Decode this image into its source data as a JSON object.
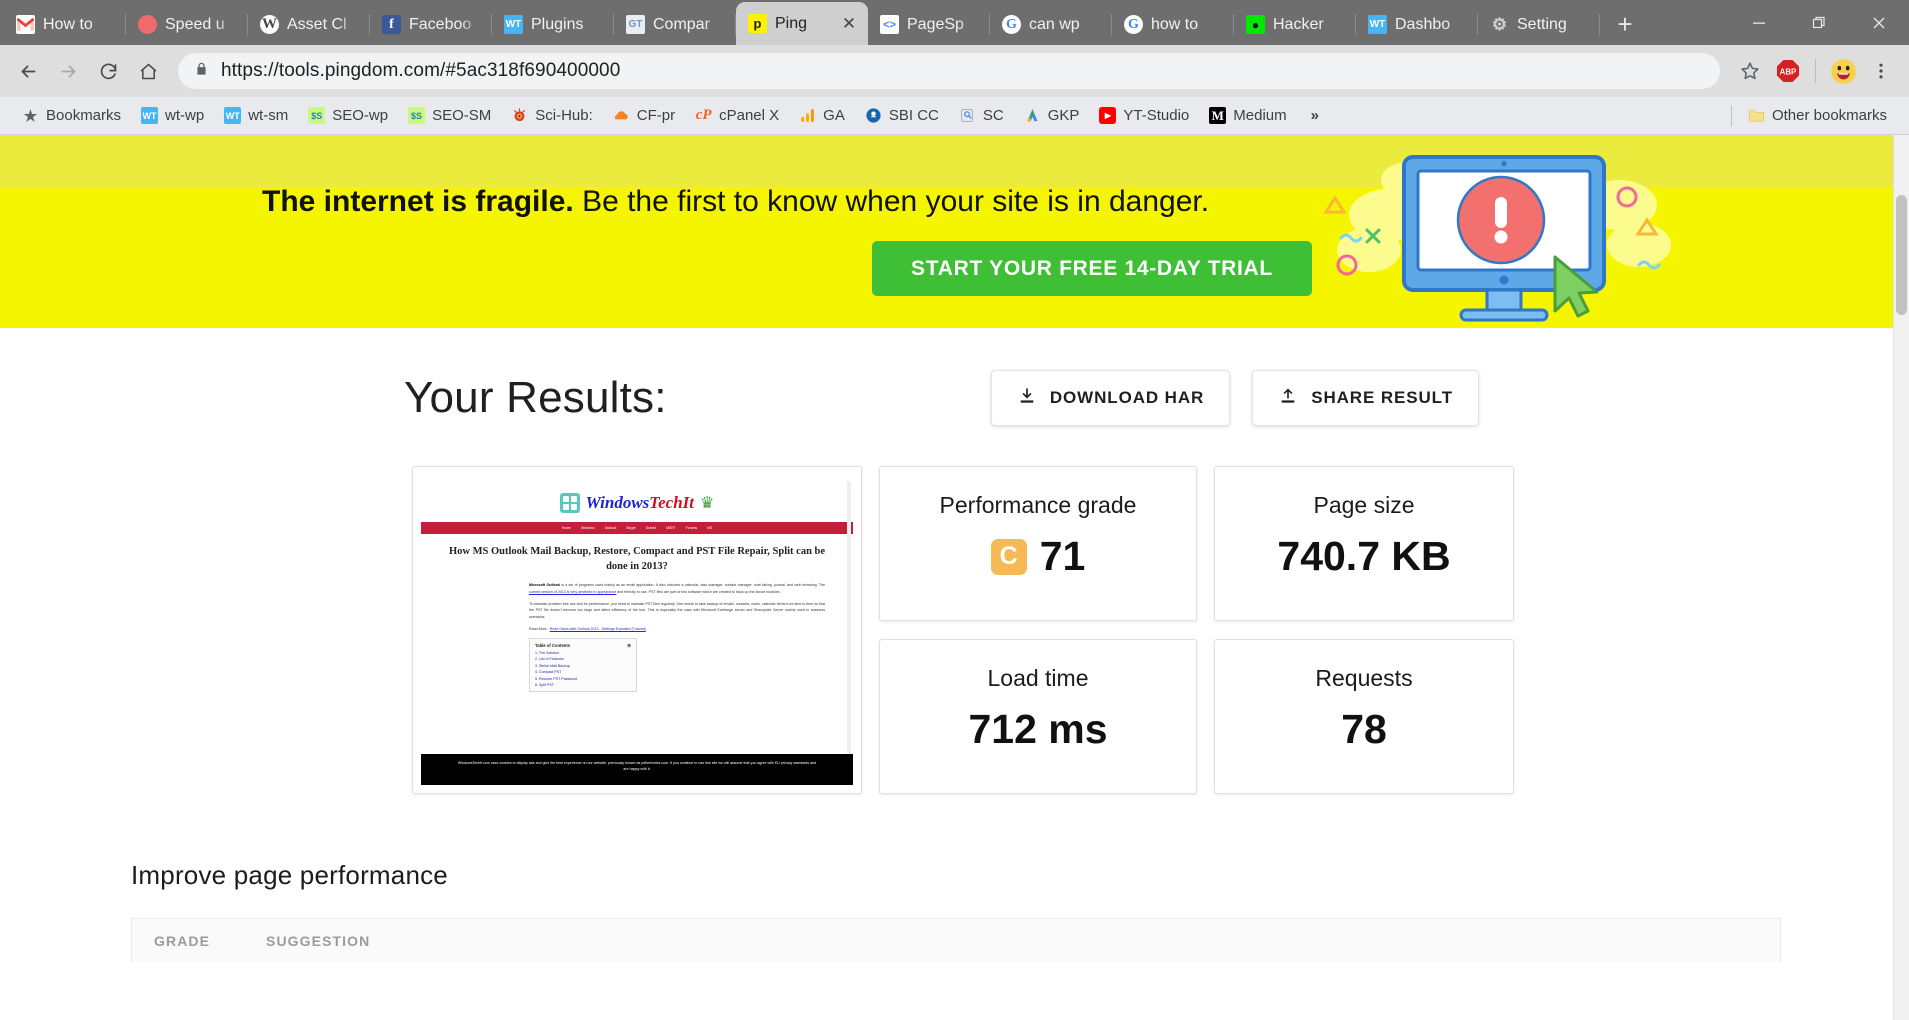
{
  "browser": {
    "tabs": [
      {
        "title": "How to",
        "favicon": "gmail-icon"
      },
      {
        "title": "Speed u",
        "favicon": "speed-icon"
      },
      {
        "title": "Asset Cl",
        "favicon": "wordpress-icon"
      },
      {
        "title": "Faceboo",
        "favicon": "facebook-icon"
      },
      {
        "title": "Plugins",
        "favicon": "wt-icon"
      },
      {
        "title": "Compar",
        "favicon": "gt-icon"
      },
      {
        "title": "Ping",
        "favicon": "pingdom-icon",
        "active": true
      },
      {
        "title": "PageSp",
        "favicon": "pagespeed-icon"
      },
      {
        "title": "can wp",
        "favicon": "google-icon"
      },
      {
        "title": "how to",
        "favicon": "google-icon"
      },
      {
        "title": "Hacker",
        "favicon": "hacker-icon"
      },
      {
        "title": "Dashbo",
        "favicon": "wt-icon"
      },
      {
        "title": "Setting",
        "favicon": "gear-icon"
      }
    ],
    "new_tab_label": "+",
    "window_controls": {
      "minimize": "—",
      "restore": "❐",
      "close": "✕"
    },
    "url": "https://tools.pingdom.com/#5ac318f690400000",
    "secure_icon": "lock-icon",
    "nav": {
      "back": "←",
      "forward": "→",
      "reload": "↻",
      "home": "⌂"
    },
    "toolbar_right": [
      {
        "name": "bookmark-star-icon",
        "label": "☆"
      },
      {
        "name": "adblock-plus-icon",
        "label": "ABP"
      },
      {
        "name": "profile-avatar",
        "label": "😃"
      },
      {
        "name": "chrome-menu-icon",
        "label": "⋮"
      }
    ],
    "bookmarks": [
      {
        "label": "Bookmarks",
        "icon": "star-icon"
      },
      {
        "label": "wt-wp",
        "icon": "wt-icon"
      },
      {
        "label": "wt-sm",
        "icon": "wt-icon"
      },
      {
        "label": "SEO-wp",
        "icon": "ss-icon"
      },
      {
        "label": "SEO-SM",
        "icon": "ss-icon"
      },
      {
        "label": "Sci-Hub:",
        "icon": "scihub-icon"
      },
      {
        "label": "CF-pr",
        "icon": "cloudflare-icon"
      },
      {
        "label": "cPanel X",
        "icon": "cpanel-icon"
      },
      {
        "label": "GA",
        "icon": "google-analytics-icon"
      },
      {
        "label": "SBI CC",
        "icon": "sbi-icon"
      },
      {
        "label": "SC",
        "icon": "search-console-icon"
      },
      {
        "label": "GKP",
        "icon": "google-keyword-planner-icon"
      },
      {
        "label": "YT-Studio",
        "icon": "youtube-icon"
      },
      {
        "label": "Medium",
        "icon": "medium-icon"
      }
    ],
    "bookmarks_overflow": "»",
    "other_bookmarks": {
      "label": "Other bookmarks",
      "icon": "folder-icon"
    }
  },
  "promo": {
    "headline_bold": "The internet is fragile.",
    "headline_rest": " Be the first to know when your site is in danger.",
    "cta_label": "START YOUR FREE 14-DAY TRIAL",
    "background_color": "#f5f500",
    "cta_color": "#3fbf36",
    "illustration": "monitor-alert-illustration"
  },
  "results": {
    "title": "Your Results:",
    "download_har_label": "DOWNLOAD HAR",
    "download_har_icon": "download-icon",
    "share_result_label": "SHARE RESULT",
    "share_result_icon": "share-upload-icon",
    "cards": [
      {
        "label": "Performance grade",
        "value": "71",
        "grade": "C",
        "grade_color": "#f5b955"
      },
      {
        "label": "Page size",
        "value": "740.7 KB"
      },
      {
        "label": "Load time",
        "value": "712 ms"
      },
      {
        "label": "Requests",
        "value": "78"
      }
    ]
  },
  "thumbnail": {
    "site_name_part1": "Windows",
    "site_name_part2": "TechIt",
    "nav_items": [
      "Home",
      "Windows",
      "Outlook",
      "Skype",
      "Solved",
      "MSRT",
      "Forums",
      "MS"
    ],
    "heading": "How MS Outlook Mail Backup, Restore, Compact and PST File Repair, Split can be done in 2013?",
    "paragraph1_lead": "Microsoft Outlook",
    "paragraph1": " is a set of programs used mainly as an email application. It also includes a calendar, task manager, contact manager, note taking, journal, and web browsing. The ",
    "paragraph1_link": "current version of 2013 is very aesthetic in appearance",
    "paragraph1_end": " and friendly to use. PST files are part of this software which are created to back up the above modules.",
    "paragraph2": "To maintain problem-free use and for performance, you need to maintain PST files regularly. One needs to take backup of emails, contacts, notes, calendar items from time to time so that the PST file doesn't become too large and affect efficiency of the tool. This is especially the case with Microsoft Exchange server and Sharepoint Server mainly used in business scenarios.",
    "read_more_label": "Read More : ",
    "read_more_link": "Read Gains with Outlook 2013 - Settings Exploited (Tutorial)",
    "toc_title": "Table of Contents",
    "toc_items": [
      "1. The Solution",
      "2. List of Features",
      "3. Stellar Mail Backup",
      "4. Compact PST",
      "5. Recover PST Password",
      "6. Split PST"
    ],
    "cookie_notice": "WindowsTechIt.com uses cookies to display ads and give the best experience on our website, previously known as pdfservivies.com. If you continue to use this site we will assume that you agree with EU privacy standards and are happy with it."
  },
  "improve": {
    "title": "Improve page performance",
    "columns": [
      "GRADE",
      "SUGGESTION"
    ]
  }
}
